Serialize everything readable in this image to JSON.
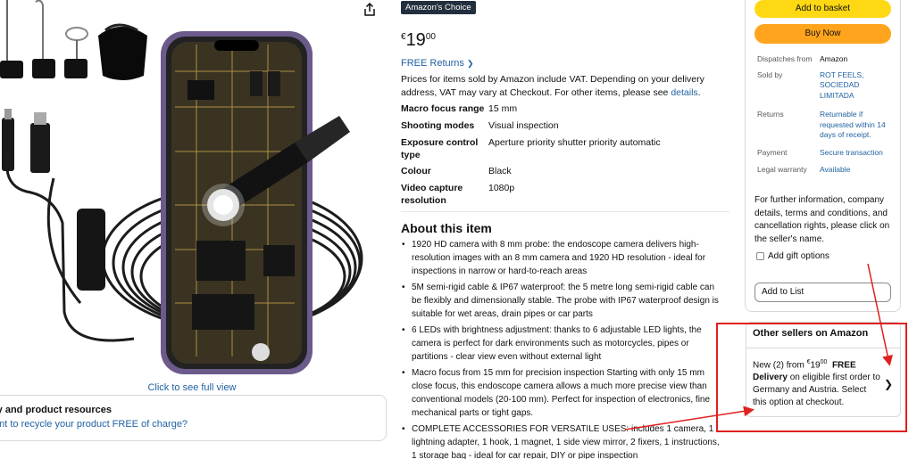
{
  "gallery": {
    "see_full_view": "Click to see full view",
    "safety_title": "ty and product resources",
    "safety_link": "ant to recycle your product FREE of charge?"
  },
  "product": {
    "badge": "Amazon's Choice",
    "price_symbol": "€",
    "price_whole": "19",
    "price_fraction": "00",
    "free_returns": "FREE Returns",
    "vat_text": "Prices for items sold by Amazon include VAT. Depending on your delivery address, VAT may vary at Checkout. For other items, please see",
    "vat_link": "details",
    "specs": [
      {
        "k": "Macro focus range",
        "v": "15 mm"
      },
      {
        "k": "Shooting modes",
        "v": "Visual inspection"
      },
      {
        "k": "Exposure control type",
        "v": "Aperture priority shutter priority automatic"
      },
      {
        "k": "Colour",
        "v": "Black"
      },
      {
        "k": "Video capture resolution",
        "v": "1080p"
      }
    ],
    "about_title": "About this item",
    "about": [
      "1920 HD camera with 8 mm probe: the endoscope camera delivers high-resolution images with an 8 mm camera and 1920 HD resolution - ideal for inspections in narrow or hard-to-reach areas",
      "5M semi-rigid cable & IP67 waterproof: the 5 metre long semi-rigid cable can be flexibly and dimensionally stable. The probe with IP67 waterproof design is suitable for wet areas, drain pipes or car parts",
      "6 LEDs with brightness adjustment: thanks to 6 adjustable LED lights, the camera is perfect for dark environments such as motorcycles, pipes or partitions - clear view even without external light",
      "Macro focus from 15 mm for precision inspection Starting with only 15 mm close focus, this endoscope camera allows a much more precise view than conventional models (20-100 mm). Perfect for inspection of electronics, fine mechanical parts or tight gaps.",
      "COMPLETE ACCESSORIES FOR VERSATILE USES: includes 1 camera, 1 lightning adapter, 1 hook, 1 magnet, 1 side view mirror, 2 fixers, 1 instructions, 1 storage bag - ideal for car repair, DIY or pipe inspection"
    ]
  },
  "buybox": {
    "add_to_basket": "Add to basket",
    "buy_now": "Buy Now",
    "info": [
      {
        "k": "Dispatches from",
        "v": "Amazon",
        "plain": true
      },
      {
        "k": "Sold by",
        "v": "ROT FEELS, SOCIEDAD LIMITADA",
        "plain": false
      },
      {
        "k": "Returns",
        "v": "Returnable if requested within 14 days of receipt.",
        "plain": false
      },
      {
        "k": "Payment",
        "v": "Secure transaction",
        "plain": false
      },
      {
        "k": "Legal warranty",
        "v": "Available",
        "plain": false
      }
    ],
    "further_info": "For further information, company details, terms and conditions, and cancellation rights, please click on the seller's name.",
    "gift_options": "Add gift options",
    "add_to_list": "Add to List"
  },
  "other_sellers": {
    "title": "Other sellers on Amazon",
    "new_prefix": "New (2) from ",
    "price_symbol": "€",
    "price_whole": "19",
    "price_fraction": "00",
    "free_label": "FREE Delivery",
    "rest": " on eligible first order to Germany and Austria. Select this option at checkout."
  },
  "colors": {
    "link": "#2162a1",
    "basket_button": "#ffd814",
    "buy_button": "#ffa41c",
    "annotation_red": "#e02020"
  }
}
